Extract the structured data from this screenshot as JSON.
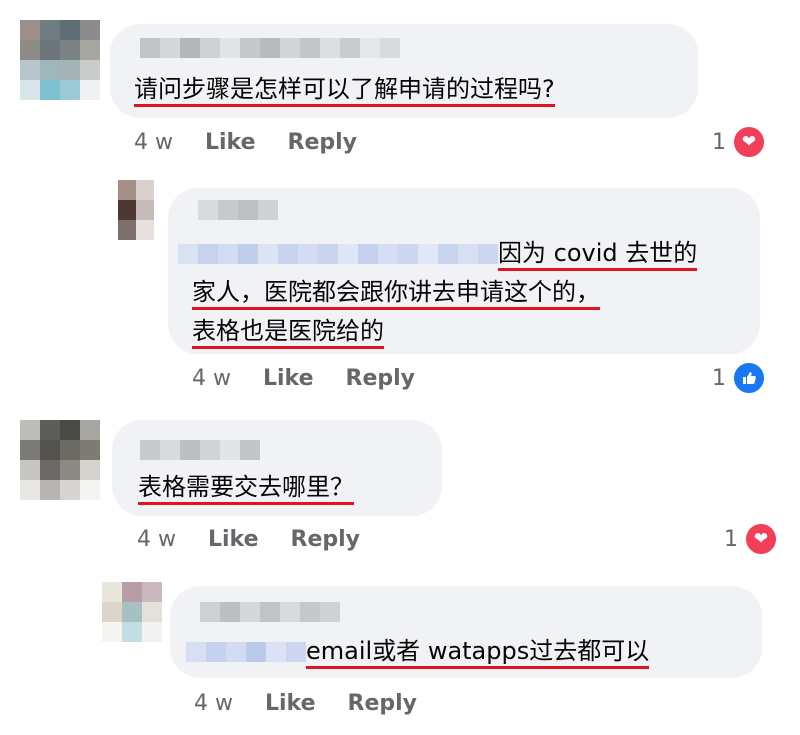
{
  "comments": [
    {
      "text": "请问步骤是怎样可以了解申请的过程吗?",
      "time": "4 w",
      "like_label": "Like",
      "reply_label": "Reply",
      "reaction_count": "1",
      "reaction_icon": "heart-icon",
      "reaction_color": "#f33e58"
    },
    {
      "text_line1": "因为 covid 去世的",
      "text_line2": "家人，医院都会跟你讲去申请这个的，",
      "text_line3": "表格也是医院给的",
      "time": "4 w",
      "like_label": "Like",
      "reply_label": "Reply",
      "reaction_count": "1",
      "reaction_icon": "thumbs-up-icon",
      "reaction_color": "#1877f2"
    },
    {
      "text": "表格需要交去哪里？",
      "time": "4 w",
      "like_label": "Like",
      "reply_label": "Reply",
      "reaction_count": "1",
      "reaction_icon": "heart-icon",
      "reaction_color": "#f33e58"
    },
    {
      "text": "email或者 watapps过去都可以",
      "time": "4 w",
      "like_label": "Like",
      "reply_label": "Reply"
    }
  ],
  "colors": {
    "bubble_bg": "#f0f2f5",
    "underline": "#e0141e",
    "meta_text": "#65676b"
  }
}
